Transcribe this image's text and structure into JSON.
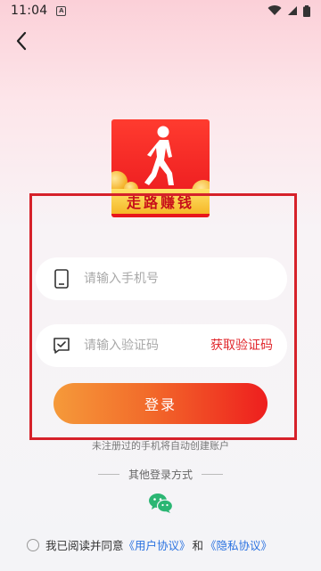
{
  "status_bar": {
    "time": "11:04",
    "notification_glyph": "A"
  },
  "logo": {
    "banner_text": "走路赚钱"
  },
  "phone_field": {
    "placeholder": "请输入手机号"
  },
  "code_field": {
    "placeholder": "请输入验证码",
    "get_code_label": "获取验证码"
  },
  "login_button": {
    "label": "登录"
  },
  "hint": "未注册过的手机将自动创建账户",
  "other_login": {
    "label": "其他登录方式"
  },
  "agreement": {
    "prefix": "我已阅读并同意",
    "user_agreement": "《用户协议》",
    "and": "和",
    "privacy_agreement": "《隐私协议》"
  },
  "colors": {
    "accent_red": "#e0262b",
    "link_blue": "#2a72e0",
    "wechat_green": "#2bb673"
  }
}
